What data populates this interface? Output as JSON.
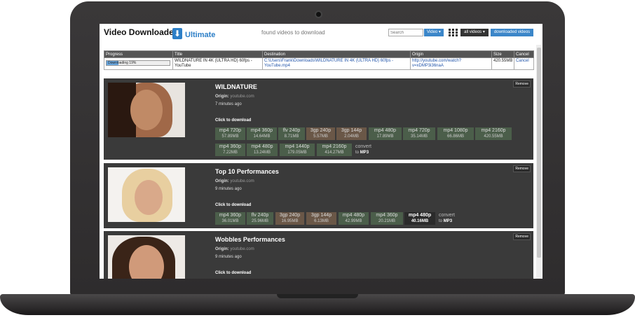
{
  "header": {
    "title": "Video Downloader",
    "subtitle": "Ultimate",
    "found_text": "found videos to download",
    "search_placeholder": "Search",
    "video_select": "Video ▾",
    "all_videos_select": "all videos ▾",
    "downloaded_button": "downloaded videos"
  },
  "download_table": {
    "columns": [
      "Progress",
      "Title",
      "Destination",
      "Origin",
      "Size",
      "Cancel"
    ],
    "row": {
      "progress_text": "Downloading 19%",
      "progress_value": 19,
      "title": "WILDNATURE IN 4K (ULTRA HD) 60fps - YouTube",
      "destination": "C:\\Users\\Frank\\Downloads\\WILDNATURE IN 4K (ULTRA HD) 60fps - YouTube.mp4",
      "origin": "http://youtube.com/watch?v=xDMP3i36naA",
      "size": "420.55MB",
      "cancel": "Cancel"
    }
  },
  "cards": [
    {
      "title": "WILDNATURE",
      "origin_label": "Origin:",
      "origin": "youtube.com",
      "time": "7 minutes ago",
      "click": "Click to download",
      "remove": "Remove",
      "formats": [
        {
          "label": "mp4 720p",
          "size": "57.89MB",
          "style": "green"
        },
        {
          "label": "mp4 360p",
          "size": "14.64MB",
          "style": "green"
        },
        {
          "label": "flv 240p",
          "size": "8.71MB",
          "style": "green"
        },
        {
          "label": "3gp 240p",
          "size": "5.57MB",
          "style": "brown"
        },
        {
          "label": "3gp 144p",
          "size": "2.04MB",
          "style": "brown"
        },
        {
          "label": "mp4 480p",
          "size": "17.89MB",
          "style": "green"
        },
        {
          "label": "mp4 720p",
          "size": "35.14MB",
          "style": "green"
        },
        {
          "label": "mp4 1080p",
          "size": "66.86MB",
          "style": "green"
        },
        {
          "label": "mp4 2160p",
          "size": "420.55MB",
          "style": "green"
        },
        {
          "label": "mp4 360p",
          "size": "7.22MB",
          "style": "green"
        },
        {
          "label": "mp4 480p",
          "size": "13.24MB",
          "style": "green"
        },
        {
          "label": "mp4 1440p",
          "size": "179.05MB",
          "style": "green"
        },
        {
          "label": "mp4 2160p",
          "size": "414.27MB",
          "style": "green"
        }
      ],
      "convert": "convert",
      "convert_to": "to",
      "convert_mp3": "MP3"
    },
    {
      "title": "Top 10 Performances",
      "origin_label": "Origin:",
      "origin": "youtube.com",
      "time": "9 minutes ago",
      "click": "Click to download",
      "remove": "Remove",
      "formats": [
        {
          "label": "mp4 360p",
          "size": "36.01MB",
          "style": "green"
        },
        {
          "label": "flv 240p",
          "size": "25.96MB",
          "style": "green"
        },
        {
          "label": "3gp 240p",
          "size": "16.95MB",
          "style": "brown"
        },
        {
          "label": "3gp 144p",
          "size": "6.13MB",
          "style": "brown"
        },
        {
          "label": "mp4 480p",
          "size": "42.99MB",
          "style": "green"
        },
        {
          "label": "mp4 360p",
          "size": "20.21MB",
          "style": "green"
        },
        {
          "label": "mp4 480p",
          "size": "40.16MB",
          "style": "dark"
        }
      ],
      "convert": "convert",
      "convert_to": "to",
      "convert_mp3": "MP3"
    },
    {
      "title": "Wobbles Performances",
      "origin_label": "Origin:",
      "origin": "youtube.com",
      "time": "9 minutes ago",
      "click": "Click to download",
      "remove": "Remove"
    }
  ]
}
